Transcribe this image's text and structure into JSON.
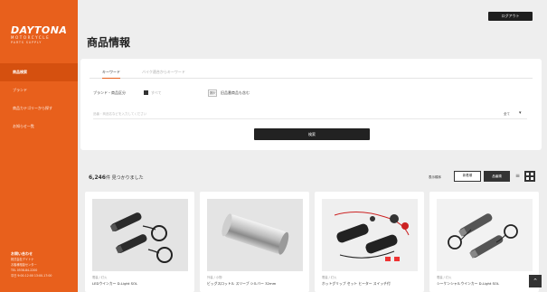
{
  "brand": {
    "logo": "DAYTONA",
    "sub": "MOTORCYCLE",
    "sub2": "PARTS SUPPLY"
  },
  "sidebar": {
    "items": [
      {
        "label": "商品検索"
      },
      {
        "label": "ブランド"
      },
      {
        "label": "商品カテゴリーから探す"
      },
      {
        "label": "お知らせ一覧"
      }
    ],
    "footer": {
      "title": "お問い合わせ",
      "lines": [
        "株式会社デイトナ",
        "お客様相談センター",
        "TEL 0538-84-2200",
        "平日 9:00-12:00 13:00-17:00"
      ]
    }
  },
  "header": {
    "top_button": "ログアウト",
    "page_title": "商品情報"
  },
  "search": {
    "tabs": [
      {
        "label": "キーワード"
      },
      {
        "label": "バイク適合からキーワード"
      }
    ],
    "filter_label": "ブランド・商品区分",
    "filter_checkbox_label": "すべて",
    "filter_check_label": "選択",
    "filter_option_label": "旧品番商品も含む",
    "input_placeholder": "品番・商品名などを入力してください",
    "select_value": "全て",
    "select_chevron": "▾",
    "submit_label": "検索"
  },
  "results": {
    "count": "6,246",
    "count_suffix": "件 見つかりました",
    "sort_label": "表示順序",
    "sort_options": [
      "新着順",
      "品番順"
    ],
    "view_list_icon": "list-icon",
    "view_grid_icon": "grid-icon"
  },
  "products": [
    {
      "category": "電装 / 灯火",
      "name": "LEDウインカー D-Light SOL",
      "image": "turn-signal"
    },
    {
      "category": "外装 / 小物",
      "name": "ビッグスロットル スリーブ シルバー 32mm",
      "image": "chrome-sleeve"
    },
    {
      "category": "電装 / 灯火",
      "name": "ホットグリップ セット ヒーター スイッチ付",
      "image": "grip-heater"
    },
    {
      "category": "電装 / 灯火",
      "name": "シーケンシャルウインカー D-Light SOL",
      "image": "turn-signal-2"
    }
  ],
  "colors": {
    "accent": "#e8601c",
    "dark": "#222222",
    "background": "#eeeeee"
  }
}
